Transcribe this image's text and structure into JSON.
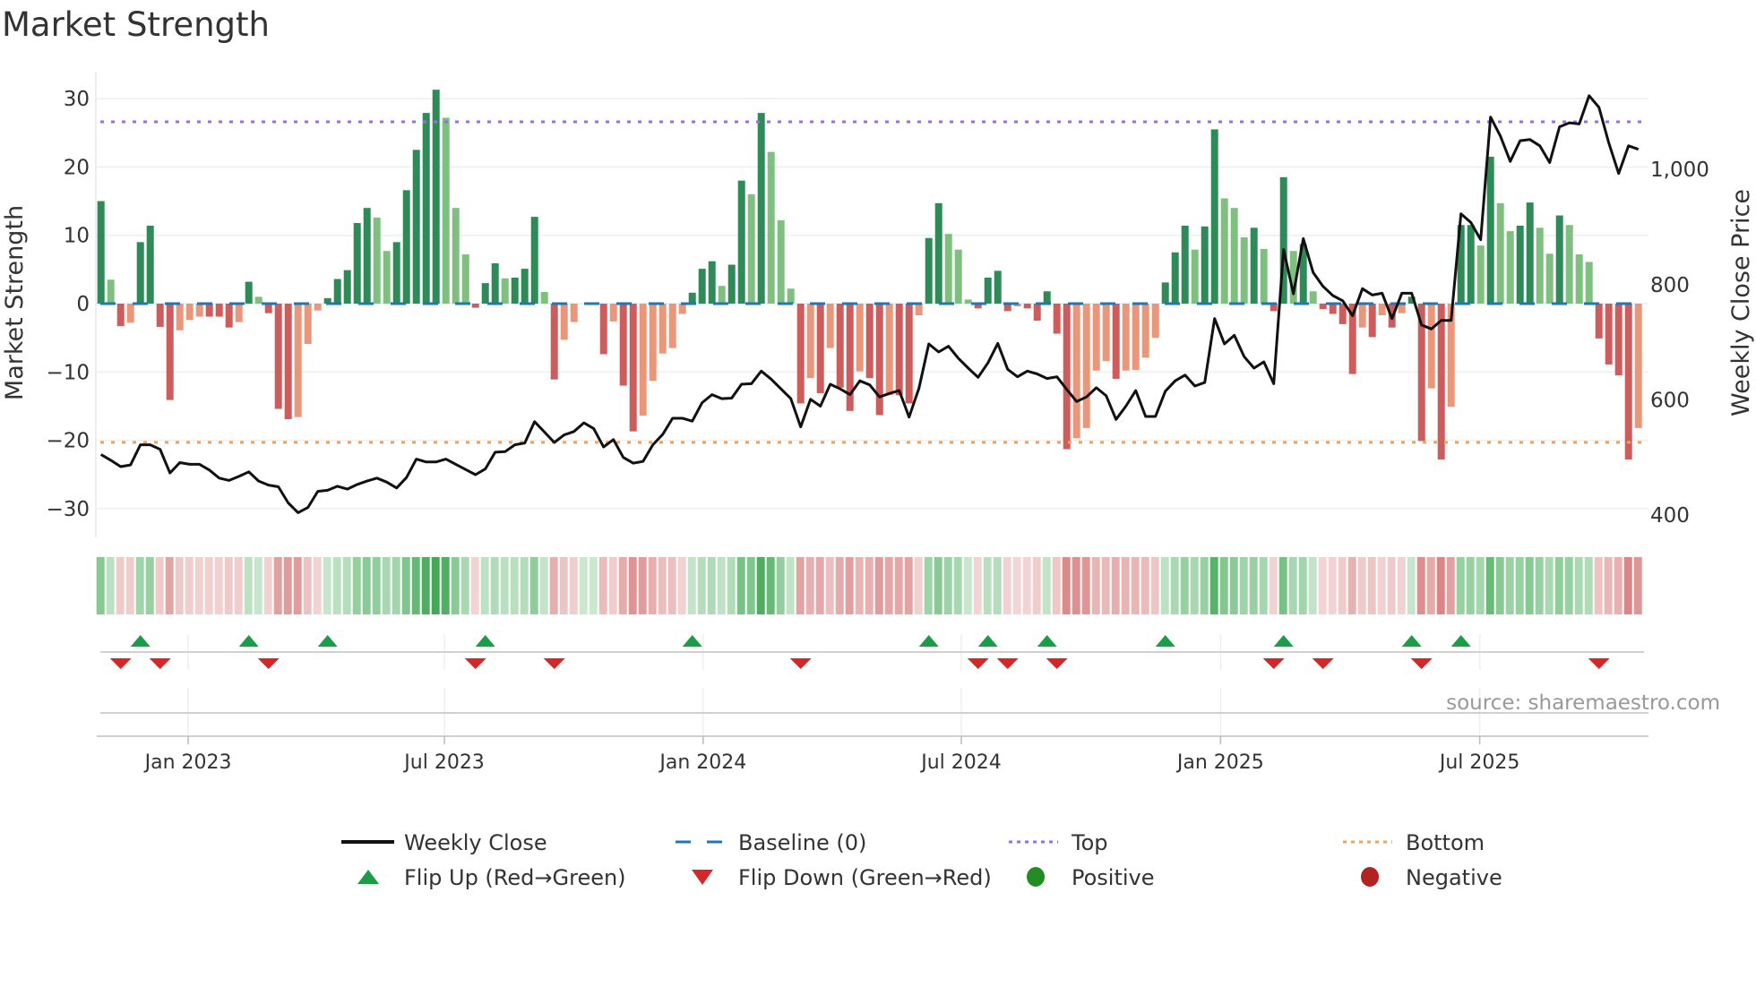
{
  "chart_data": {
    "type": "bar",
    "title": "Market Strength",
    "ylabel": "Market Strength",
    "y2label": "Weekly Close Price",
    "ylim": [
      -32,
      33
    ],
    "y2lim": [
      400,
      1180
    ],
    "yticks": [
      30,
      20,
      10,
      0,
      -10,
      -20,
      -30
    ],
    "yticklabels": [
      "30",
      "20",
      "10",
      "0",
      "−10",
      "−20",
      "−30"
    ],
    "y2ticks": [
      1000,
      800,
      600,
      400
    ],
    "y2ticklabels": [
      "1,000",
      "800",
      "600",
      "400"
    ],
    "xticks_week_index": [
      8.85,
      34.85,
      61.1,
      87.3,
      113.6,
      139.9
    ],
    "xticklabels": [
      "Jan 2023",
      "Jul 2023",
      "Jan 2024",
      "Jul 2024",
      "Jan 2025",
      "Jul 2025"
    ],
    "top_level": 26.6,
    "bottom_level": -20.3,
    "baseline": 0,
    "grid": true,
    "legend_placement": "bottom",
    "colors": {
      "pos_strong": "#2e8b57",
      "pos_weak": "#7fbf7f",
      "neg_strong": "#cd5c5c",
      "neg_weak": "#e9967a",
      "baseline": "#1f77b4",
      "top": "#9b6ee0",
      "bottom": "#f0a35c",
      "close": "#111111",
      "flip_up": "#1a9e45",
      "flip_down": "#d62728",
      "positive": "#228b22",
      "negative": "#b22222"
    },
    "strength": [
      15.0,
      3.5,
      -3.3,
      -2.8,
      9.0,
      11.4,
      -3.4,
      -14.1,
      -3.9,
      -2.4,
      -1.9,
      -1.9,
      -1.9,
      -3.5,
      -2.7,
      3.2,
      1.0,
      -1.4,
      -15.4,
      -16.9,
      -16.6,
      -5.9,
      -1.0,
      0.8,
      3.6,
      4.9,
      11.8,
      14.0,
      12.6,
      7.7,
      9.0,
      16.6,
      22.5,
      27.9,
      31.3,
      27.2,
      14.0,
      7.2,
      -0.6,
      3.0,
      5.9,
      3.7,
      3.8,
      5.1,
      12.7,
      1.7,
      -11.1,
      -5.3,
      -2.7,
      0,
      0,
      -7.4,
      -2.6,
      -12.0,
      -18.7,
      -16.4,
      -11.3,
      -7.3,
      -6.5,
      -1.5,
      1.6,
      5.1,
      6.2,
      2.6,
      5.7,
      18.0,
      16.0,
      27.9,
      22.2,
      12.2,
      2.2,
      -14.6,
      -10.9,
      -13.1,
      -6.5,
      -12.3,
      -15.7,
      -9.9,
      -10.9,
      -16.3,
      -13.4,
      -13.4,
      -14.6,
      -1.7,
      9.6,
      14.7,
      10.2,
      7.9,
      0.6,
      -0.7,
      3.8,
      4.8,
      -1.1,
      -0.4,
      -0.7,
      -2.5,
      1.8,
      -4.4,
      -21.3,
      -19.7,
      -18.2,
      -9.8,
      -8.4,
      -11.0,
      -9.8,
      -9.7,
      -7.9,
      -5.0,
      3.1,
      7.5,
      11.4,
      7.9,
      11.3,
      25.5,
      15.4,
      14.0,
      9.7,
      11.1,
      8.0,
      -1.1,
      18.5,
      7.7,
      8.7,
      1.8,
      -0.8,
      -1.5,
      -3.0,
      -10.3,
      -3.5,
      -4.9,
      -1.7,
      -3.5,
      -1.4,
      1.0,
      -20.1,
      -12.4,
      -22.8,
      -15.1,
      11.5,
      11.5,
      8.5,
      21.5,
      14.7,
      10.6,
      11.4,
      14.8,
      11.1,
      7.3,
      12.9,
      11.5,
      7.2,
      6.1,
      -5.1,
      -8.9,
      -10.5,
      -22.8,
      -18.2
    ],
    "weekly_close": [
      505,
      495,
      484,
      487,
      522,
      522,
      514,
      473,
      491,
      488,
      488,
      478,
      464,
      460,
      467,
      475,
      459,
      452,
      449,
      421,
      404,
      413,
      441,
      443,
      450,
      445,
      453,
      459,
      464,
      457,
      447,
      465,
      497,
      492,
      492,
      497,
      488,
      479,
      470,
      480,
      509,
      510,
      522,
      525,
      562,
      544,
      526,
      539,
      545,
      560,
      550,
      518,
      531,
      500,
      490,
      493,
      522,
      540,
      568,
      568,
      563,
      595,
      609,
      602,
      603,
      627,
      628,
      650,
      636,
      619,
      602,
      553,
      601,
      589,
      627,
      619,
      609,
      633,
      626,
      605,
      611,
      616,
      570,
      620,
      697,
      683,
      693,
      672,
      655,
      639,
      664,
      698,
      653,
      640,
      650,
      645,
      637,
      640,
      618,
      597,
      605,
      621,
      607,
      566,
      589,
      616,
      571,
      571,
      615,
      633,
      643,
      624,
      630,
      741,
      697,
      712,
      675,
      655,
      666,
      628,
      861,
      784,
      880,
      821,
      797,
      781,
      772,
      746,
      793,
      782,
      785,
      741,
      785,
      785,
      730,
      723,
      738,
      738,
      923,
      908,
      878,
      1091,
      1058,
      1014,
      1050,
      1052,
      1041,
      1012,
      1074,
      1081,
      1079,
      1128,
      1108,
      1046,
      993,
      1041,
      1035
    ],
    "flip_up_weeks": [
      5,
      16,
      24,
      40,
      61,
      85,
      91,
      97,
      109,
      121,
      134,
      139
    ],
    "flip_down_weeks": [
      3,
      7,
      18,
      39,
      47,
      72,
      90,
      93,
      98,
      120,
      125,
      135,
      153
    ],
    "legend": [
      {
        "key": "weekly-close",
        "label": "Weekly Close"
      },
      {
        "key": "baseline",
        "label": "Baseline (0)"
      },
      {
        "key": "top",
        "label": "Top"
      },
      {
        "key": "bottom",
        "label": "Bottom"
      },
      {
        "key": "flip-up",
        "label": "Flip Up (Red→Green)"
      },
      {
        "key": "flip-down",
        "label": "Flip Down (Green→Red)"
      },
      {
        "key": "positive",
        "label": "Positive"
      },
      {
        "key": "negative",
        "label": "Negative"
      }
    ],
    "source": "source: sharemaestro.com"
  }
}
